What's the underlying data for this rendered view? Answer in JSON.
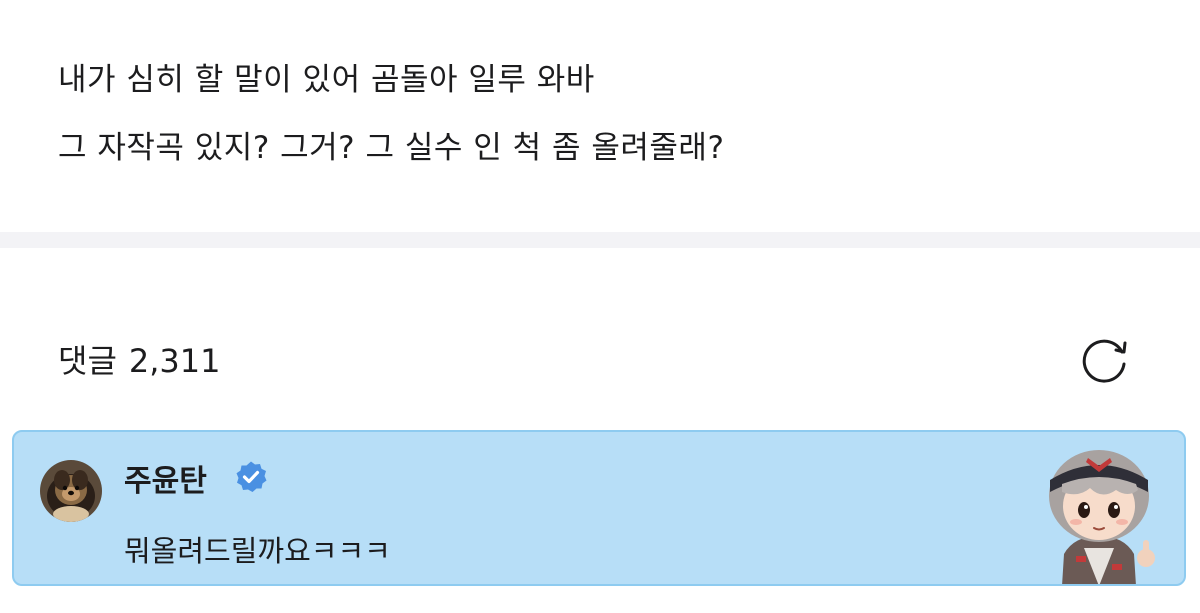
{
  "post": {
    "line1": "내가 심히 할 말이 있어 곰돌아 일루 와바",
    "line2": "그 자작곡 있지? 그거? 그 실수 인 척 좀 올려줄래?"
  },
  "comments": {
    "title": "댓글",
    "count": "2,311",
    "refresh_icon": "refresh-icon"
  },
  "highlighted_comment": {
    "author": "주윤탄",
    "verified_icon": "verified-badge-icon",
    "text": "뭐올려드릴까요ㅋㅋㅋ",
    "avatar_icon": "dog-avatar",
    "sticker_icon": "character-sticker"
  },
  "colors": {
    "card_bg": "#b7def7",
    "card_border": "#8ecbf0",
    "verified": "#4a90e2",
    "divider": "#f3f3f6"
  }
}
